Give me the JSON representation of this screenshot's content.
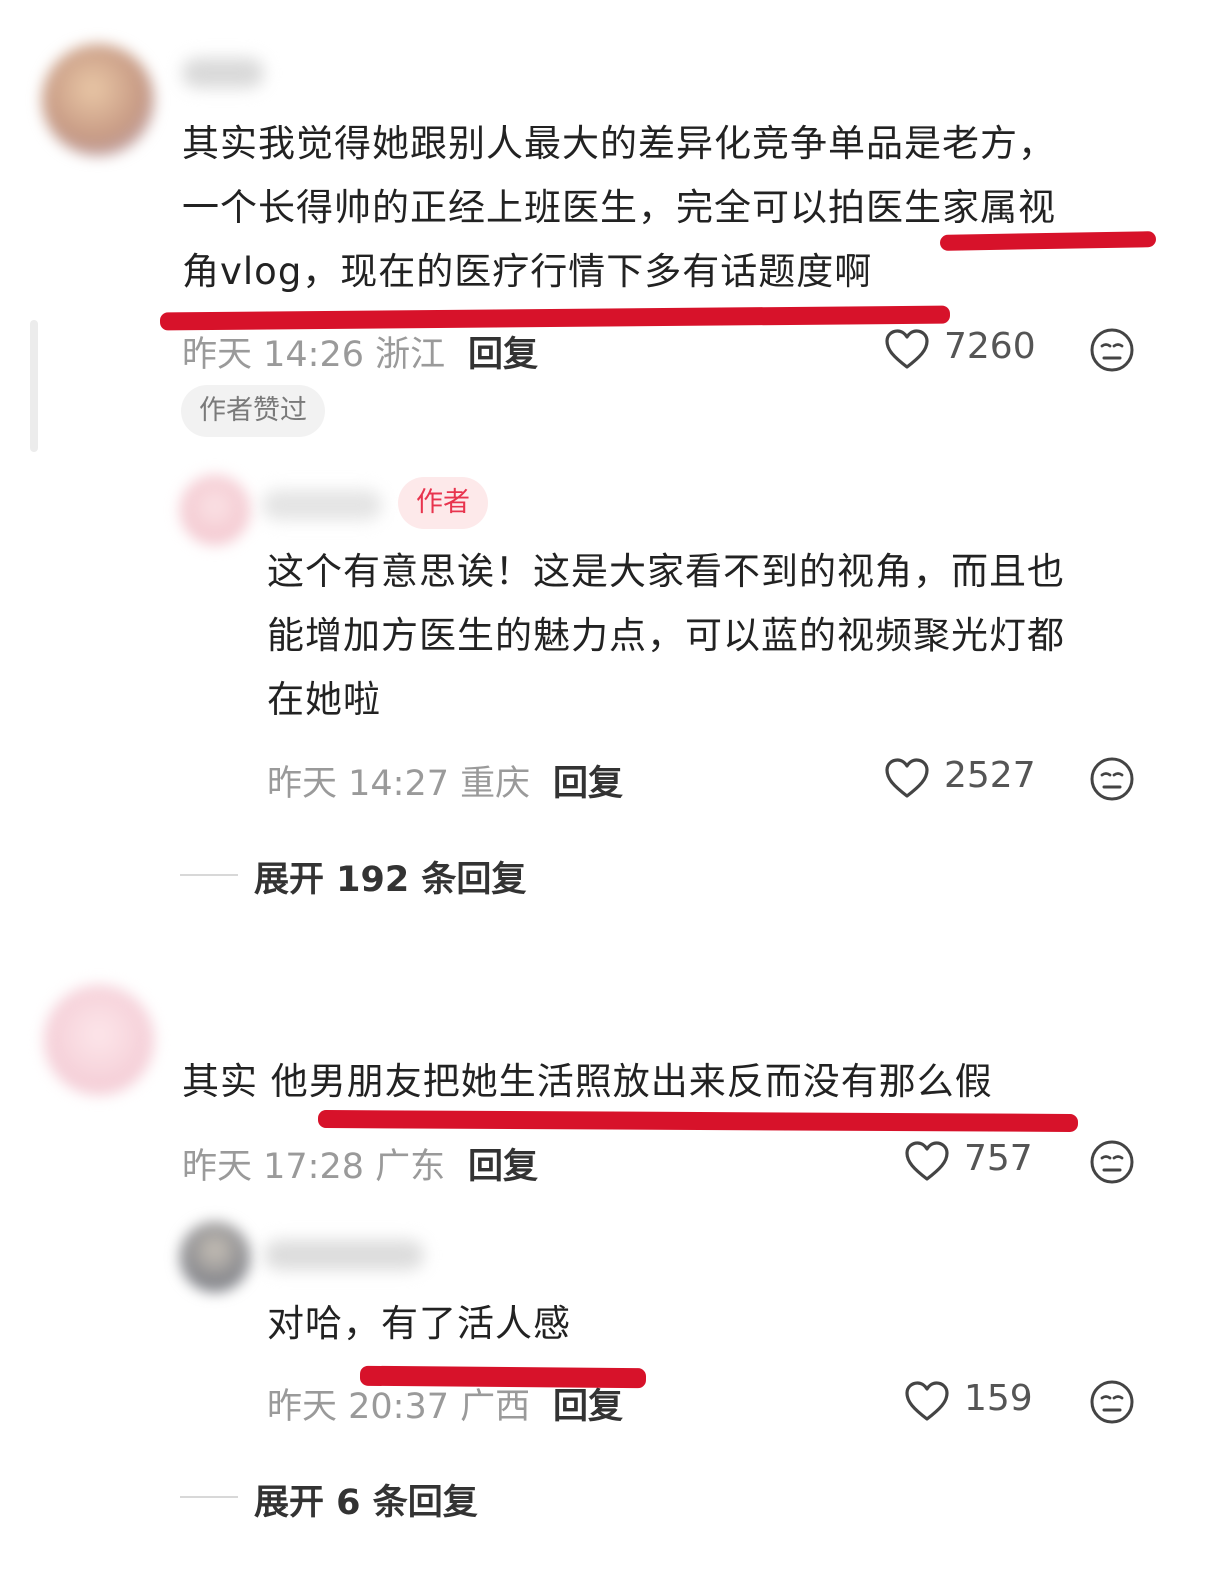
{
  "comments": [
    {
      "text_lines": [
        "其实我觉得她跟别人最大的差异化竞争单品是老方，",
        "一个长得帅的正经上班医生，完全可以拍医生家属视",
        "角vlog，现在的医疗行情下多有话题度啊"
      ],
      "meta": "昨天 14:26 浙江",
      "reply_label": "回复",
      "likes": "7260",
      "liked_badge": "作者赞过",
      "reply": {
        "author_badge": "作者",
        "text_lines": [
          "这个有意思诶！这是大家看不到的视角，而且也",
          "能增加方医生的魅力点，可以蓝的视频聚光灯都",
          "在她啦"
        ],
        "meta": "昨天 14:27 重庆",
        "reply_label": "回复",
        "likes": "2527"
      },
      "expand": "展开 192 条回复"
    },
    {
      "text_lines": [
        "其实 他男朋友把她生活照放出来反而没有那么假"
      ],
      "meta": "昨天 17:28 广东",
      "reply_label": "回复",
      "likes": "757",
      "reply": {
        "text_lines": [
          "对哈，有了活人感"
        ],
        "meta": "昨天 20:37 广西",
        "reply_label": "回复",
        "likes": "159"
      },
      "expand": "展开 6 条回复"
    }
  ],
  "icons": {
    "like": "heart-outline-icon",
    "dislike": "meh-face-icon"
  },
  "colors": {
    "marker": "#d7122a",
    "author_badge": "#e8344e"
  }
}
